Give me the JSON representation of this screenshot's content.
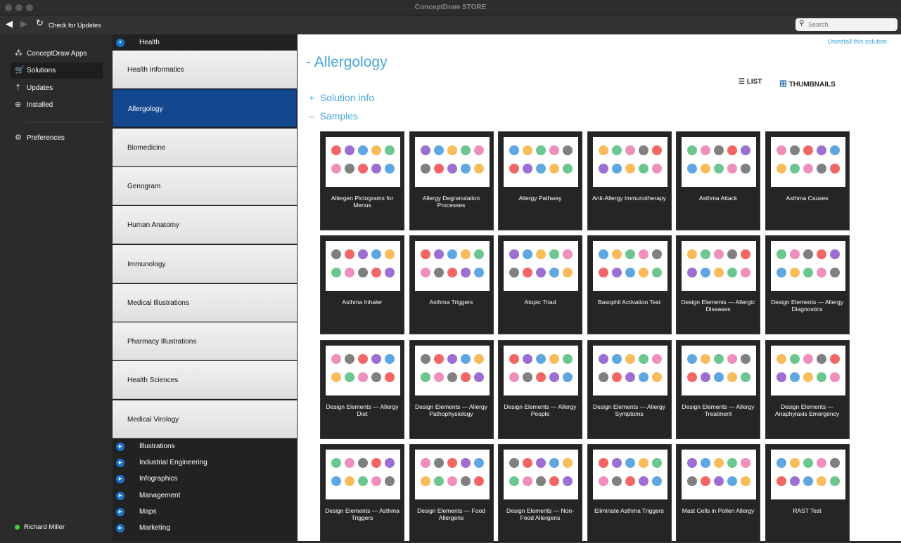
{
  "window": {
    "title": "ConceptDraw STORE"
  },
  "toolbar": {
    "check_updates": "Check for Updates",
    "search_placeholder": "Search"
  },
  "nav": [
    {
      "label": "ConceptDraw Apps",
      "icon": "apps-icon"
    },
    {
      "label": "Solutions",
      "icon": "cart-icon",
      "active": true
    },
    {
      "label": "Updates",
      "icon": "updates-icon"
    },
    {
      "label": "Installed",
      "icon": "download-icon"
    },
    {
      "label": "Preferences",
      "icon": "gear-icon"
    }
  ],
  "user": {
    "name": "Richard Miller",
    "status_color": "#3fcf3f"
  },
  "categories": {
    "group": "Health",
    "items": [
      "Health Informatics",
      "Allergology",
      "Biomedicine",
      "Genogram",
      "Human Anatomy",
      "Immunology",
      "Medical Illustrations",
      "Pharmacy Illustrations",
      "Health Sciences",
      "Medical Virology"
    ],
    "selected": "Allergology",
    "other_groups": [
      "Illustrations",
      "Industrial Engineering",
      "Infographics",
      "Management",
      "Maps",
      "Marketing"
    ]
  },
  "main": {
    "uninstall": "Uninstall this solution",
    "title": "Allergology",
    "title_prefix": "-",
    "solution_info": "Solution info",
    "samples": "Samples",
    "list_label": "LIST",
    "thumbnails_label": "THUMBNAILS",
    "accent": "#48a6dd",
    "samples_list": [
      "Allergen Pictograms for Menus",
      "Allergy Degranulation Processes",
      "Allergy Pathway",
      "Anti-Allergy Immunotherapy",
      "Asthma Attack",
      "Asthma Causes",
      "Asthma Inhaler",
      "Asthma Triggers",
      "Atopic Triad",
      "Basophil Activation Test",
      "Design Elements — Allergic Diseases",
      "Design Elements — Allergy Diagnostics",
      "Design Elements — Allergy Diet",
      "Design Elements — Allergy Pathophysiology",
      "Design Elements — Allergy People",
      "Design Elements — Allergy Symptoms",
      "Design Elements — Allergy Treatment",
      "Design Elements — Anaphylaxis Emergency",
      "Design Elements — Asthma Triggers",
      "Design Elements — Food Allergens",
      "Design Elements — Non-Food Allergens",
      "Eliminate Asthma Triggers",
      "Mast Cells in Pollen Allergy",
      "RAST Test"
    ]
  }
}
